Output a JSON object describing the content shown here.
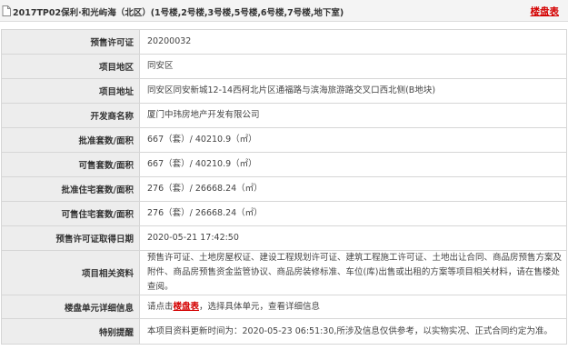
{
  "header": {
    "title": "2017TP02保利·和光屿海（北区）(1号楼,2号楼,3号楼,5号楼,6号楼,7号楼,地下室)",
    "link_label": "楼盘表"
  },
  "rows": [
    {
      "label": "预售许可证",
      "value": "20200032"
    },
    {
      "label": "项目地区",
      "value": "同安区"
    },
    {
      "label": "项目地址",
      "value": "同安区同安新城12-14西柯北片区通福路与滨海旅游路交叉口西北侧(B地块)"
    },
    {
      "label": "开发商名称",
      "value": "厦门中玮房地产开发有限公司"
    },
    {
      "label": "批准套数/面积",
      "value": "667（套）/ 40210.9（㎡）"
    },
    {
      "label": "可售套数/面积",
      "value": "667（套）/ 40210.9（㎡）"
    },
    {
      "label": "批准住宅套数/面积",
      "value": "276（套）/ 26668.24（㎡）"
    },
    {
      "label": "可售住宅套数/面积",
      "value": "276（套）/ 26668.24（㎡）"
    },
    {
      "label": "预售许可证取得日期",
      "value": "2020-05-21 17:42:50"
    },
    {
      "label": "项目相关资料",
      "value": "预售许可证、土地房屋权证、建设工程规划许可证、建筑工程施工许可证、土地出让合同、商品房预售方案及附件、商品房预售资金监管协议、商品房装修标准、车位(库)出售或出租的方案等项目相关材料，请在售楼处查阅。"
    },
    {
      "label": "楼盘单元详细信息",
      "value_before": "请点击",
      "value_link": "楼盘表",
      "value_after": "，选择具体单元，查看详细信息"
    },
    {
      "label": "特别提醒",
      "value": "本项目资料更新时间为：2020-05-23 06:51:30,所涉及信息仅供参考，以实物实况、正式合同约定为准。"
    }
  ]
}
